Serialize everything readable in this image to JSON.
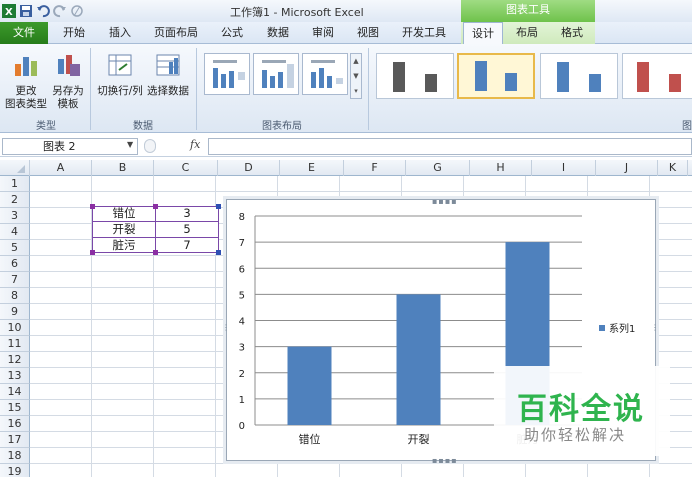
{
  "app": {
    "title": "工作簿1 - Microsoft Excel",
    "context_header": "图表工具"
  },
  "tabs": [
    {
      "label": "文件"
    },
    {
      "label": "开始"
    },
    {
      "label": "插入"
    },
    {
      "label": "页面布局"
    },
    {
      "label": "公式"
    },
    {
      "label": "数据"
    },
    {
      "label": "审阅"
    },
    {
      "label": "视图"
    },
    {
      "label": "开发工具"
    },
    {
      "label": "设计"
    },
    {
      "label": "布局"
    },
    {
      "label": "格式"
    }
  ],
  "ribbon": {
    "change_type_1": "更改",
    "change_type_2": "图表类型",
    "save_template_1": "另存为",
    "save_template_2": "模板",
    "switch_row_col": "切换行/列",
    "select_data": "选择数据",
    "group_type": "类型",
    "group_data": "数据",
    "group_layout": "图表布局",
    "group_styles": "图"
  },
  "formula_bar": {
    "name_box": "图表 2",
    "fx": "fx",
    "value": ""
  },
  "columns": [
    "A",
    "B",
    "C",
    "D",
    "E",
    "F",
    "G",
    "H",
    "I",
    "J",
    "K"
  ],
  "rows": [
    "1",
    "2",
    "3",
    "4",
    "5",
    "6",
    "7",
    "8",
    "9",
    "10",
    "11",
    "12",
    "13",
    "14",
    "15",
    "16",
    "17",
    "18",
    "19"
  ],
  "cells": {
    "B3": "错位",
    "C3": "3",
    "B4": "开裂",
    "C4": "5",
    "B5": "脏污",
    "C5": "7"
  },
  "chart_data": {
    "type": "bar",
    "categories": [
      "错位",
      "开裂",
      "脏污"
    ],
    "series": [
      {
        "name": "系列1",
        "values": [
          3,
          5,
          7
        ],
        "color": "#4f81bd"
      }
    ],
    "ylim": [
      0,
      8
    ],
    "yticks": [
      "0",
      "1",
      "2",
      "3",
      "4",
      "5",
      "6",
      "7",
      "8"
    ],
    "grid": true,
    "legend": "right"
  },
  "watermark": {
    "title": "百科全说",
    "subtitle": "助你轻松解决"
  },
  "colors": {
    "file_tab": "#267c1a",
    "context_tab": "#6fc24b",
    "bar": "#4f81bd",
    "selection": "#7a48a8"
  }
}
